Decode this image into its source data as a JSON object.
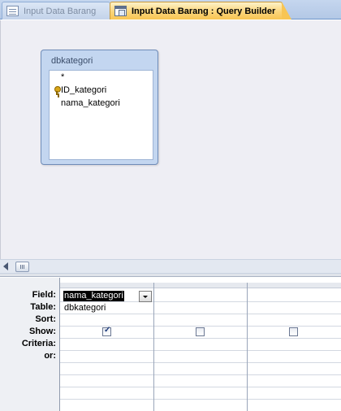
{
  "tabs": [
    {
      "label": "Input Data Barang",
      "active": false,
      "icon": "form-icon"
    },
    {
      "label": "Input Data Barang : Query Builder",
      "active": true,
      "icon": "query-icon"
    }
  ],
  "table_box": {
    "title": "dbkategori",
    "fields": [
      {
        "label": "*",
        "primary_key": false
      },
      {
        "label": "ID_kategori",
        "primary_key": true
      },
      {
        "label": "nama_kategori",
        "primary_key": false
      }
    ]
  },
  "grid": {
    "row_labels": {
      "field": "Field:",
      "table": "Table:",
      "sort": "Sort:",
      "show": "Show:",
      "criteria": "Criteria:",
      "or": "or:"
    },
    "columns": [
      {
        "field": "nama_kategori",
        "table": "dbkategori",
        "sort": "",
        "show": true,
        "criteria": "",
        "or": ""
      },
      {
        "field": "",
        "table": "",
        "sort": "",
        "show": false,
        "criteria": "",
        "or": ""
      },
      {
        "field": "",
        "table": "",
        "sort": "",
        "show": false,
        "criteria": "",
        "or": ""
      }
    ]
  }
}
